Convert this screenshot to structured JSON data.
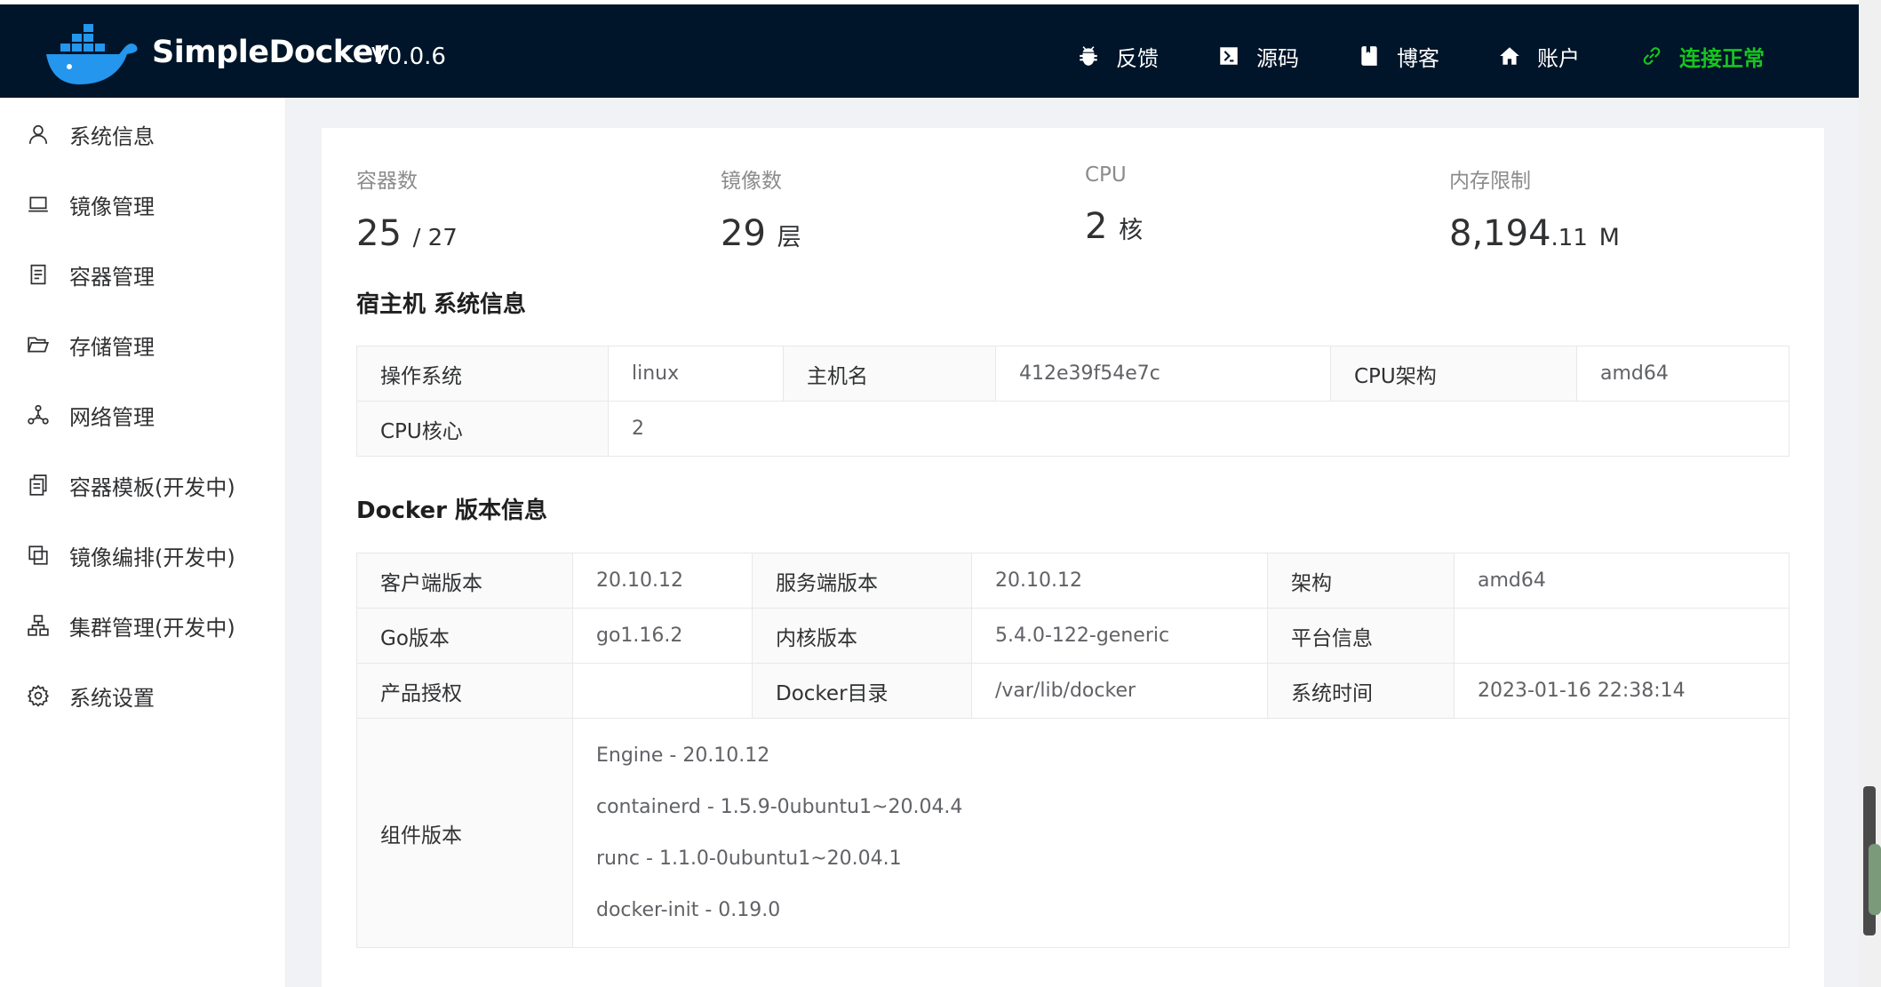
{
  "header": {
    "brand": "SimpleDocker",
    "version": "V0.0.6",
    "nav": [
      {
        "label": "反馈",
        "icon": "bug-icon"
      },
      {
        "label": "源码",
        "icon": "terminal-icon"
      },
      {
        "label": "博客",
        "icon": "book-icon"
      },
      {
        "label": "账户",
        "icon": "home-icon"
      }
    ],
    "status": {
      "label": "连接正常",
      "icon": "link-icon",
      "color": "#16c51f"
    }
  },
  "sidebar": {
    "items": [
      {
        "label": "系统信息",
        "icon": "user-icon"
      },
      {
        "label": "镜像管理",
        "icon": "laptop-icon"
      },
      {
        "label": "容器管理",
        "icon": "file-text-icon"
      },
      {
        "label": "存储管理",
        "icon": "folder-open-icon"
      },
      {
        "label": "网络管理",
        "icon": "network-icon"
      },
      {
        "label": "容器模板(开发中)",
        "icon": "copy-icon"
      },
      {
        "label": "镜像编排(开发中)",
        "icon": "layers-icon"
      },
      {
        "label": "集群管理(开发中)",
        "icon": "cluster-icon"
      },
      {
        "label": "系统设置",
        "icon": "gear-icon"
      }
    ]
  },
  "stats": {
    "containers": {
      "label": "容器数",
      "value": "25",
      "suffix": "/ 27"
    },
    "images": {
      "label": "镜像数",
      "value": "29",
      "suffix": "层"
    },
    "cpu": {
      "label": "CPU",
      "value": "2",
      "suffix": "核"
    },
    "memory": {
      "label": "内存限制",
      "value": "8,194",
      "decimal": ".11",
      "suffix": "M"
    }
  },
  "host": {
    "title": "宿主机 系统信息",
    "os_label": "操作系统",
    "os": "linux",
    "hostname_label": "主机名",
    "hostname": "412e39f54e7c",
    "arch_label": "CPU架构",
    "arch": "amd64",
    "cores_label": "CPU核心",
    "cores": "2"
  },
  "docker": {
    "title": "Docker 版本信息",
    "client_label": "客户端版本",
    "client": "20.10.12",
    "server_label": "服务端版本",
    "server": "20.10.12",
    "arch_label": "架构",
    "arch": "amd64",
    "go_label": "Go版本",
    "go": "go1.16.2",
    "kernel_label": "内核版本",
    "kernel": "5.4.0-122-generic",
    "platform_label": "平台信息",
    "platform": "",
    "license_label": "产品授权",
    "license": "",
    "root_label": "Docker目录",
    "root": "/var/lib/docker",
    "time_label": "系统时间",
    "time": "2023-01-16 22:38:14",
    "components_label": "组件版本",
    "components": [
      "Engine - 20.10.12",
      "containerd - 1.5.9-0ubuntu1~20.04.4",
      "runc - 1.1.0-0ubuntu1~20.04.1",
      "docker-init - 0.19.0"
    ]
  }
}
